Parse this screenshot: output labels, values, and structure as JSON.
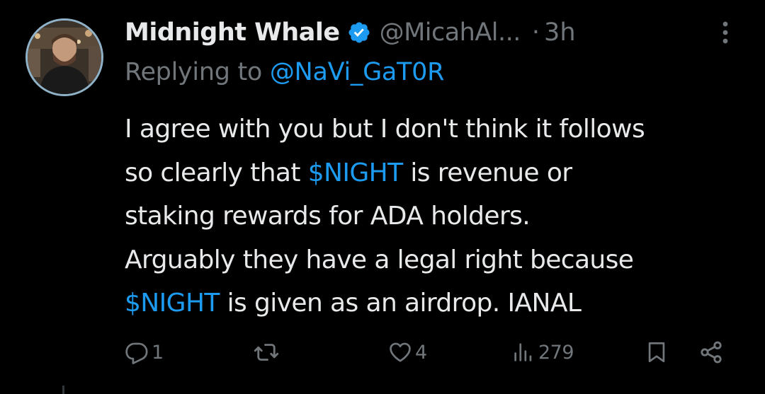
{
  "tweet": {
    "author": {
      "display_name": "Midnight Whale",
      "handle": "@MicahAl...",
      "verified": true
    },
    "timestamp": "3h",
    "separator": "·",
    "replying": {
      "prefix": "Replying to",
      "mention": "@NaVi_GaT0R"
    },
    "body_lines": [
      [
        {
          "text": "I agree with you but I don't think it follows"
        }
      ],
      [
        {
          "text": "so clearly that "
        },
        {
          "text": "$NIGHT",
          "cashtag": true
        },
        {
          "text": " is revenue or"
        }
      ],
      [
        {
          "text": "staking rewards for ADA holders."
        }
      ],
      [
        {
          "text": "Arguably they have a legal right because"
        }
      ],
      [
        {
          "text": "$NIGHT",
          "cashtag": true
        },
        {
          "text": " is given as an airdrop. IANAL"
        }
      ]
    ],
    "actions": {
      "reply_count": "1",
      "retweet_count": "",
      "like_count": "4",
      "views_count": "279"
    }
  },
  "icons": {
    "verified": "verified-badge-icon",
    "more": "more-vertical-icon",
    "reply": "reply-icon",
    "retweet": "retweet-icon",
    "like": "heart-icon",
    "views": "views-icon",
    "bookmark": "bookmark-icon",
    "share": "share-icon"
  },
  "colors": {
    "background": "#000000",
    "text_primary": "#e7e9ea",
    "text_secondary": "#71767b",
    "accent": "#1d9bf0"
  }
}
